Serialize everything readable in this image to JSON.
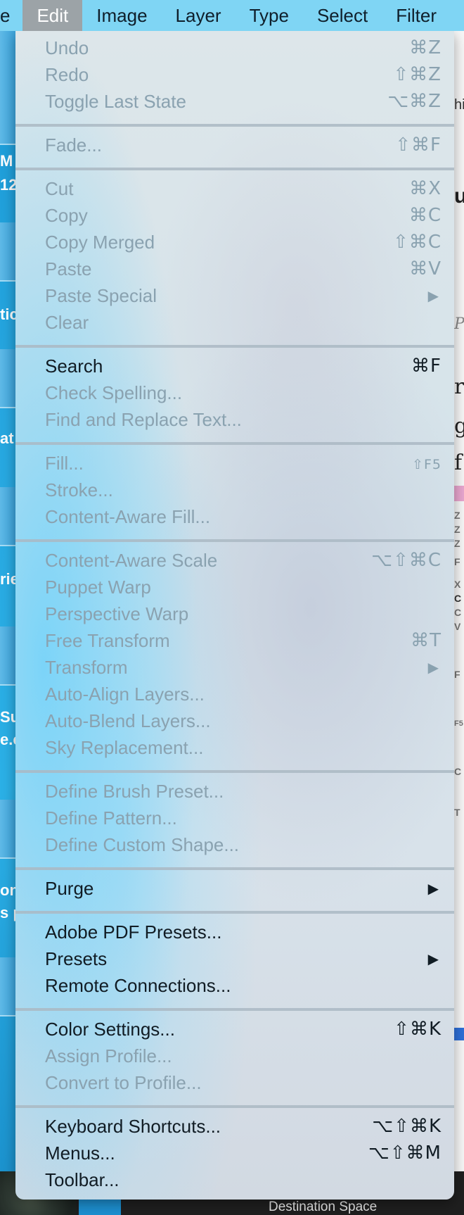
{
  "menubar": {
    "items": [
      {
        "label": "e",
        "active": false
      },
      {
        "label": "Edit",
        "active": true
      },
      {
        "label": "Image",
        "active": false
      },
      {
        "label": "Layer",
        "active": false
      },
      {
        "label": "Type",
        "active": false
      },
      {
        "label": "Select",
        "active": false
      },
      {
        "label": "Filter",
        "active": false
      }
    ]
  },
  "edit_menu": {
    "undo": {
      "label": "Undo",
      "shortcut": "⌘Z"
    },
    "redo": {
      "label": "Redo",
      "shortcut": "⇧⌘Z"
    },
    "toggle_last_state": {
      "label": "Toggle Last State",
      "shortcut": "⌥⌘Z"
    },
    "fade": {
      "label": "Fade...",
      "shortcut": "⇧⌘F"
    },
    "cut": {
      "label": "Cut",
      "shortcut": "⌘X"
    },
    "copy": {
      "label": "Copy",
      "shortcut": "⌘C"
    },
    "copy_merged": {
      "label": "Copy Merged",
      "shortcut": "⇧⌘C"
    },
    "paste": {
      "label": "Paste",
      "shortcut": "⌘V"
    },
    "paste_special": {
      "label": "Paste Special",
      "submenu": "▶"
    },
    "clear": {
      "label": "Clear"
    },
    "search": {
      "label": "Search",
      "shortcut": "⌘F"
    },
    "check_spelling": {
      "label": "Check Spelling..."
    },
    "find_replace": {
      "label": "Find and Replace Text..."
    },
    "fill": {
      "label": "Fill...",
      "shortcut": "⇧F5"
    },
    "stroke": {
      "label": "Stroke..."
    },
    "content_aware_fill": {
      "label": "Content-Aware Fill..."
    },
    "content_aware_scale": {
      "label": "Content-Aware Scale",
      "shortcut": "⌥⇧⌘C"
    },
    "puppet_warp": {
      "label": "Puppet Warp"
    },
    "perspective_warp": {
      "label": "Perspective Warp"
    },
    "free_transform": {
      "label": "Free Transform",
      "shortcut": "⌘T"
    },
    "transform": {
      "label": "Transform",
      "submenu": "▶"
    },
    "auto_align": {
      "label": "Auto-Align Layers..."
    },
    "auto_blend": {
      "label": "Auto-Blend Layers..."
    },
    "sky_replacement": {
      "label": "Sky Replacement..."
    },
    "define_brush": {
      "label": "Define Brush Preset..."
    },
    "define_pattern": {
      "label": "Define Pattern..."
    },
    "define_shape": {
      "label": "Define Custom Shape..."
    },
    "purge": {
      "label": "Purge",
      "submenu": "▶"
    },
    "pdf_presets": {
      "label": "Adobe PDF Presets..."
    },
    "presets": {
      "label": "Presets",
      "submenu": "▶"
    },
    "remote_connections": {
      "label": "Remote Connections..."
    },
    "color_settings": {
      "label": "Color Settings...",
      "shortcut": "⇧⌘K"
    },
    "assign_profile": {
      "label": "Assign Profile..."
    },
    "convert_profile": {
      "label": "Convert to Profile..."
    },
    "keyboard_shortcuts": {
      "label": "Keyboard Shortcuts...",
      "shortcut": "⌥⇧⌘K"
    },
    "menus": {
      "label": "Menus...",
      "shortcut": "⌥⇧⌘M"
    },
    "toolbar": {
      "label": "Toolbar..."
    }
  },
  "background": {
    "left_fragments": [
      "M",
      "12",
      "tic",
      "at",
      "rie",
      "Sul",
      "e.e",
      "on",
      "s p"
    ],
    "right_fragments": [
      "hi",
      "u",
      "P",
      "r",
      "g",
      "f"
    ],
    "right_small_letters": [
      "Z",
      "Z",
      "Z",
      "F",
      "X",
      "C",
      "C",
      "V",
      "F",
      "F5",
      "C",
      "T"
    ],
    "destination_label": "Destination Space"
  },
  "colors": {
    "menubar_bg": "#7fd5f4",
    "active_menu_bg": "#9ca3a7",
    "enabled_text": "#111c24",
    "disabled_text": "#8aa2b0"
  }
}
